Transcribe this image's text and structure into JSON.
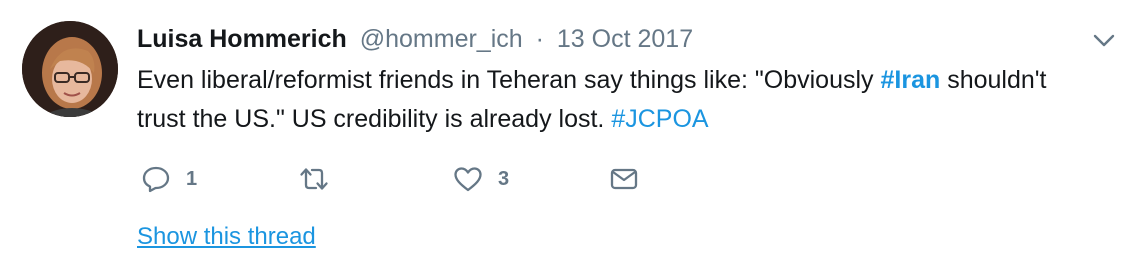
{
  "tweet": {
    "author_name": "Luisa Hommerich",
    "handle": "@hommer_ich",
    "separator": "·",
    "date": "13 Oct 2017",
    "text_part1": "Even liberal/reformist friends in Teheran say things like: \"Obviously ",
    "hashtag_iran": "#Iran",
    "text_part2": " shouldn't trust the US.\" US credibility is already lost. ",
    "hashtag_jcpoa": "#JCPOA",
    "reply_count": "1",
    "retweet_count": "",
    "like_count": "3",
    "show_thread_label": "Show this thread"
  },
  "icons": {
    "avatar": "avatar",
    "menu": "chevron-down-icon",
    "reply": "reply-icon",
    "retweet": "retweet-icon",
    "like": "heart-icon",
    "message": "envelope-icon"
  },
  "colors": {
    "link": "#1b95e0",
    "secondary_text": "#657786",
    "primary_text": "#14171a"
  }
}
